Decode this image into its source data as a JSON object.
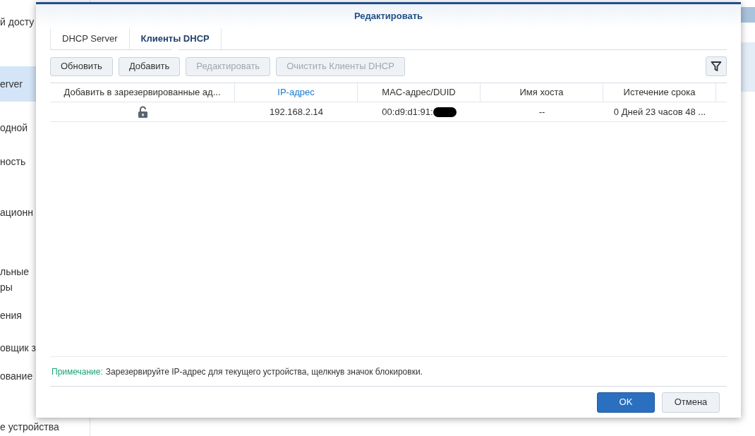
{
  "background_sidebar": {
    "items": [
      {
        "label": "й досту",
        "selected": false
      },
      {
        "label": "erver",
        "selected": true
      },
      {
        "label": "одной",
        "selected": false
      },
      {
        "label": "ность",
        "selected": false
      },
      {
        "label": "ационн",
        "selected": false
      },
      {
        "label": "льные\nры",
        "selected": false
      },
      {
        "label": "ения",
        "selected": false
      },
      {
        "label": "овщик з",
        "selected": false
      },
      {
        "label": "ование",
        "selected": false
      },
      {
        "label": "е устройства",
        "selected": false
      }
    ]
  },
  "dialog": {
    "title": "Редактировать",
    "tabs": [
      {
        "label": "DHCP Server",
        "selected": false
      },
      {
        "label": "Клиенты DHCP",
        "selected": true
      }
    ],
    "toolbar": [
      {
        "label": "Обновить",
        "disabled": false
      },
      {
        "label": "Добавить",
        "disabled": false
      },
      {
        "label": "Редактировать",
        "disabled": true
      },
      {
        "label": "Очистить Клиенты DHCP",
        "disabled": true
      }
    ],
    "table": {
      "columns": [
        {
          "label": "Добавить в зарезервированные ад...",
          "sorted": false
        },
        {
          "label": "IP-адрес",
          "sorted": true
        },
        {
          "label": "MAC-адрес/DUID",
          "sorted": false
        },
        {
          "label": "Имя хоста",
          "sorted": false
        },
        {
          "label": "Истечение срока",
          "sorted": false
        }
      ],
      "rows": [
        {
          "reserved": false,
          "ip": "192.168.2.14",
          "mac": "00:d9:d1:91:",
          "mac_redacted": true,
          "host": "--",
          "expires": "0 Дней 23 часов 48 ..."
        }
      ]
    },
    "note": {
      "label": "Примечание:",
      "text": "Зарезервируйте IP-адрес для текущего устройства, щелкнув значок блокировки."
    },
    "buttons": [
      {
        "label": "OK",
        "kind": "primary"
      },
      {
        "label": "Отмена",
        "kind": "secondary"
      }
    ]
  }
}
